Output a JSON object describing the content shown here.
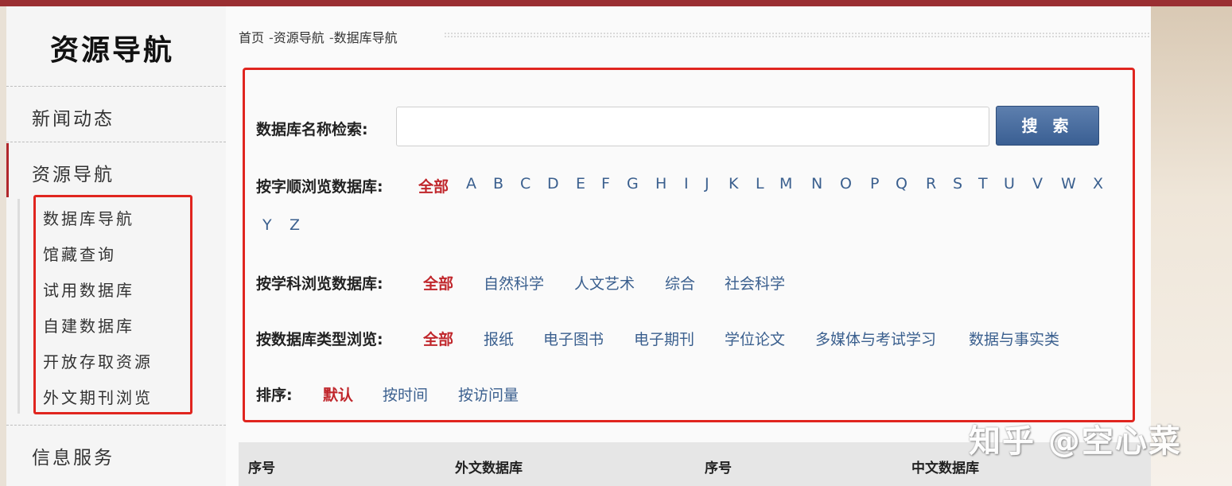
{
  "sidebar": {
    "title": "资源导航",
    "items": [
      "新闻动态",
      "资源导航",
      "信息服务"
    ],
    "subitems": [
      "数据库导航",
      "馆藏查询",
      "试用数据库",
      "自建数据库",
      "开放存取资源",
      "外文期刊浏览"
    ]
  },
  "breadcrumb": [
    "首页",
    "资源导航",
    "数据库导航"
  ],
  "breadcrumb_sep": "-",
  "search": {
    "label": "数据库名称检索:",
    "placeholder": "",
    "button": "搜 索"
  },
  "alpha": {
    "label": "按字顺浏览数据库:",
    "all": "全部",
    "letters": [
      "A",
      "B",
      "C",
      "D",
      "E",
      "F",
      "G",
      "H",
      "I",
      "J",
      "K",
      "L",
      "M",
      "N",
      "O",
      "P",
      "Q",
      "R",
      "S",
      "T",
      "U",
      "V",
      "W",
      "X",
      "Y",
      "Z"
    ]
  },
  "subject": {
    "label": "按学科浏览数据库:",
    "options": [
      "全部",
      "自然科学",
      "人文艺术",
      "综合",
      "社会科学"
    ]
  },
  "dbtype": {
    "label": "按数据库类型浏览:",
    "options": [
      "全部",
      "报纸",
      "电子图书",
      "电子期刊",
      "学位论文",
      "多媒体与考试学习",
      "数据与事实类"
    ]
  },
  "sort": {
    "label": "排序:",
    "options": [
      "默认",
      "按时间",
      "按访问量"
    ]
  },
  "table": {
    "headers": [
      "序号",
      "外文数据库",
      "序号",
      "中文数据库"
    ]
  },
  "watermark": "知乎 @空心菜",
  "colors": {
    "accent": "#c0262b",
    "link": "#3a5f8e",
    "highlight_border": "#e0251f",
    "topbar": "#9a2f32"
  }
}
